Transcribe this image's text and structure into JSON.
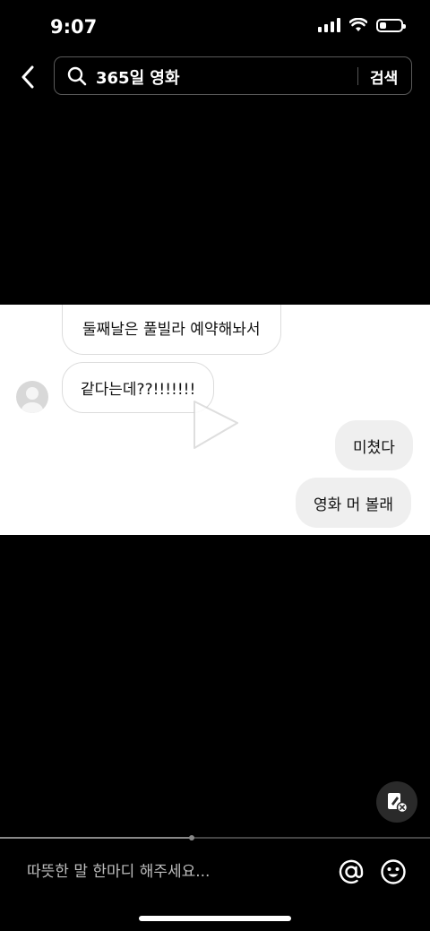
{
  "status_bar": {
    "time": "9:07"
  },
  "search": {
    "query": "365일 영화",
    "button_label": "검색"
  },
  "video": {
    "progress": 0.445,
    "messages": [
      {
        "side": "incoming",
        "text": "둘째날은 풀빌라 예약해놔서"
      },
      {
        "side": "incoming",
        "text": "같다는데??!!!!!!!"
      },
      {
        "side": "outgoing",
        "text": "미쳤다"
      },
      {
        "side": "outgoing",
        "text": "영화 머 볼래"
      }
    ]
  },
  "comment": {
    "placeholder": "따뜻한 말 한마디 해주세요..."
  },
  "icons": [
    "back-icon",
    "search-icon",
    "play-icon",
    "edit-icon",
    "mention-icon",
    "emoji-icon"
  ]
}
